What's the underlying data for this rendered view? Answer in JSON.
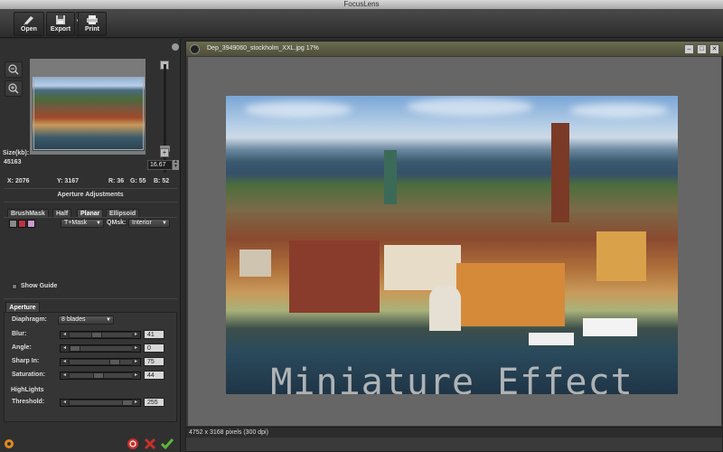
{
  "window": {
    "title": "FocusLens"
  },
  "toolbar": {
    "open_label": "Open",
    "export_label": "Export",
    "print_label": "Print"
  },
  "navigator": {
    "size_label": "Size(kb):",
    "size_value": "45163",
    "zoom_value": "16.67"
  },
  "coords": {
    "x": "X: 2076",
    "y": "Y: 3167",
    "r": "R: 36",
    "g": "G: 55",
    "b": "B: 52"
  },
  "aperture_adjustments": {
    "title": "Aperture Adjustments",
    "tabs": [
      "BrushMask",
      "Half",
      "Planar",
      "Ellipsoid"
    ],
    "mask_select": "T+Mask",
    "qmsk_label": "QMsk:",
    "qmsk_select": "Interior",
    "show_guide_label": "Show Guide"
  },
  "aperture": {
    "tab_label": "Aperture",
    "diaphragm_label": "Diaphragm:",
    "diaphragm_value": "8 blades",
    "rows": [
      {
        "label": "Blur:",
        "value": "41",
        "level": 0.41
      },
      {
        "label": "Angle:",
        "value": "0",
        "level": 0.0
      },
      {
        "label": "Sharp In:",
        "value": "75",
        "level": 0.75
      },
      {
        "label": "Saturation:",
        "value": "44",
        "level": 0.44
      }
    ],
    "highlights_label": "HighLights",
    "threshold_label": "Threshold:",
    "threshold_value": "255",
    "threshold_level": 1.0
  },
  "document": {
    "title": "Dep_3949060_stockholm_XXL.jpg 17%",
    "caption": "Miniature Effect",
    "status": "4752 x 3168 pixels (300 dpi)"
  },
  "colors": {
    "accent_red": "#c8302a",
    "accent_green": "#5cb83a",
    "accent_orange": "#e08a20"
  }
}
